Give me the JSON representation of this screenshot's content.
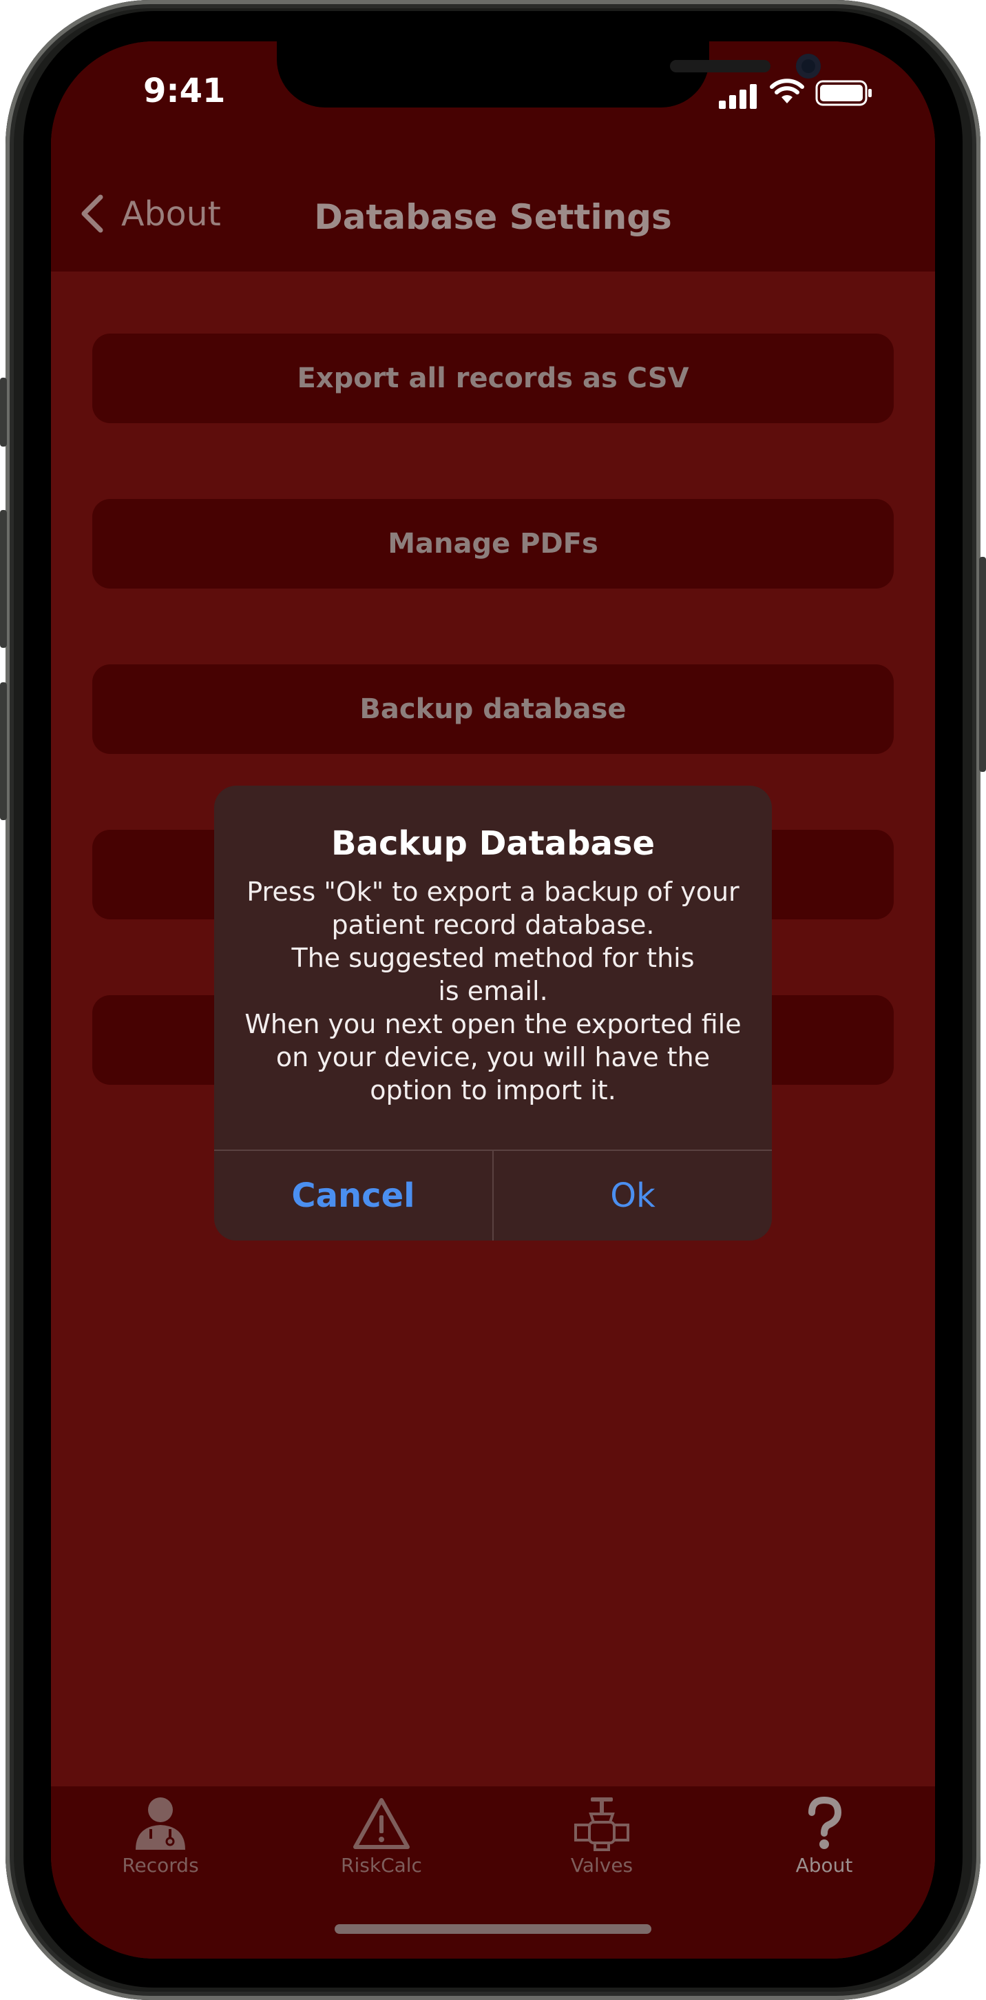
{
  "status_bar": {
    "time": "9:41"
  },
  "nav": {
    "back_label": "About",
    "title": "Database Settings"
  },
  "menu": [
    {
      "label": "Export all records as CSV"
    },
    {
      "label": "Manage PDFs"
    },
    {
      "label": "Backup database"
    },
    {
      "label": ""
    },
    {
      "label": ""
    }
  ],
  "dialog": {
    "title": "Backup Database",
    "message_lines": [
      "Press \"Ok\" to export a backup of your",
      "patient record database.",
      "The suggested method for this",
      "is email.",
      "When you next open the exported file",
      "on your device, you will have the",
      "option to import it."
    ],
    "cancel_label": "Cancel",
    "ok_label": "Ok"
  },
  "tabs": [
    {
      "label": "Records",
      "icon": "doctor-icon"
    },
    {
      "label": "RiskCalc",
      "icon": "warning-icon"
    },
    {
      "label": "Valves",
      "icon": "valve-icon"
    },
    {
      "label": "About",
      "icon": "question-icon",
      "active": true
    }
  ],
  "colors": {
    "background": "#5e0d0c",
    "bars": "#470202",
    "dialog": "#3c2221",
    "dialog_button": "#4b8ff0"
  }
}
